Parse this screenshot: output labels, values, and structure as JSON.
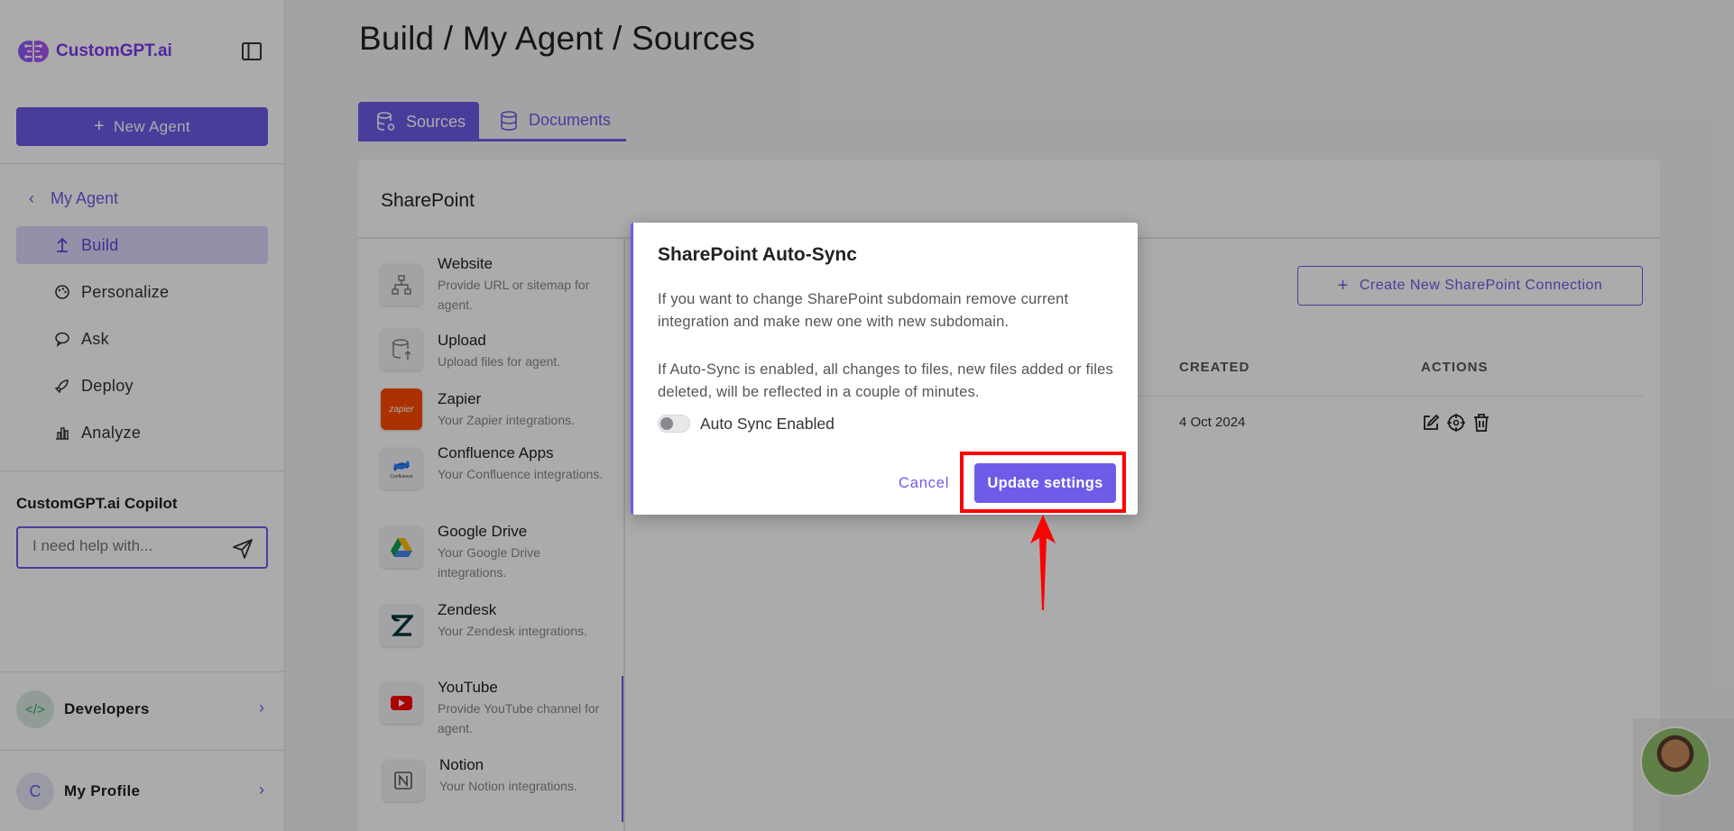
{
  "app": {
    "logo_text": "CustomGPT.ai",
    "accent_color": "#6d5ce8"
  },
  "sidebar": {
    "new_agent_label": "New Agent",
    "back_label": "My Agent",
    "nav": [
      {
        "label": "Build",
        "icon": "build-icon",
        "active": true
      },
      {
        "label": "Personalize",
        "icon": "palette-icon"
      },
      {
        "label": "Ask",
        "icon": "chat-icon"
      },
      {
        "label": "Deploy",
        "icon": "rocket-icon"
      },
      {
        "label": "Analyze",
        "icon": "chart-icon"
      }
    ],
    "copilot": {
      "title": "CustomGPT.ai Copilot",
      "placeholder": "I need help with..."
    },
    "developers_label": "Developers",
    "profile_label": "My Profile",
    "profile_initial": "C"
  },
  "main": {
    "title": "Build / My Agent / Sources",
    "tabs": [
      {
        "label": "Sources",
        "active": true
      },
      {
        "label": "Documents"
      }
    ],
    "card_title": "SharePoint",
    "sources": [
      {
        "name": "Website",
        "desc": "Provide URL or sitemap for agent."
      },
      {
        "name": "Upload",
        "desc": "Upload files for agent."
      },
      {
        "name": "Zapier",
        "desc": "Your Zapier integrations."
      },
      {
        "name": "Confluence Apps",
        "desc": "Your Confluence integrations."
      },
      {
        "name": "Google Drive",
        "desc": "Your Google Drive integrations."
      },
      {
        "name": "Zendesk",
        "desc": "Your Zendesk integrations."
      },
      {
        "name": "YouTube",
        "desc": "Provide YouTube channel for agent."
      },
      {
        "name": "Notion",
        "desc": "Your Notion integrations."
      }
    ],
    "zapier_logo_text": "zapier",
    "confluence_logo_text": "Confluence",
    "create_button": "Create New SharePoint Connection",
    "table": {
      "headers": {
        "created": "CREATED",
        "actions": "ACTIONS"
      },
      "rows": [
        {
          "created": "4 Oct 2024"
        }
      ]
    }
  },
  "modal": {
    "title": "SharePoint Auto-Sync",
    "para1": "If you want to change SharePoint subdomain remove current integration and make new one with new subdomain.",
    "para2": "If Auto-Sync is enabled, all changes to files, new files added or files deleted, will be reflected in a couple of minutes.",
    "toggle_label": "Auto Sync Enabled",
    "toggle_on": false,
    "cancel_label": "Cancel",
    "update_label": "Update settings"
  }
}
